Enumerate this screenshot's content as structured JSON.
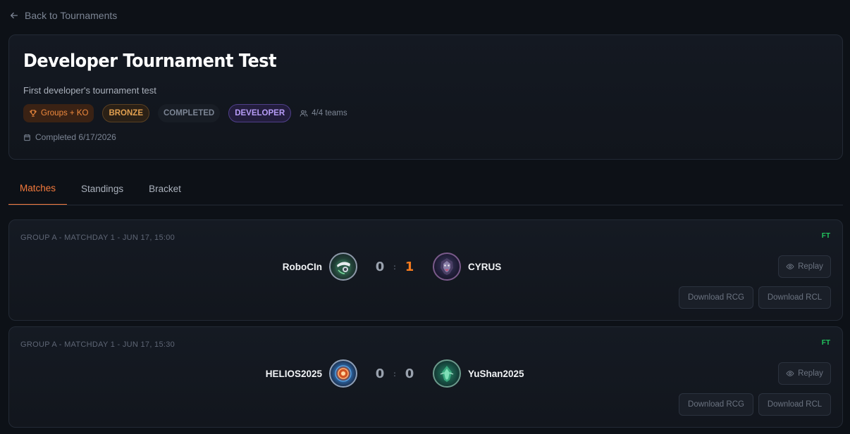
{
  "nav": {
    "back_label": "Back to Tournaments"
  },
  "tournament": {
    "title": "Developer Tournament Test",
    "description": "First developer's tournament test",
    "format": "Groups + KO",
    "tier": "BRONZE",
    "status": "COMPLETED",
    "type": "DEVELOPER",
    "teams": "4/4 teams",
    "completed": "Completed 6/17/2026"
  },
  "tabs": [
    {
      "label": "Matches",
      "active": true
    },
    {
      "label": "Standings",
      "active": false
    },
    {
      "label": "Bracket",
      "active": false
    }
  ],
  "matches": [
    {
      "label": "GROUP A - MATCHDAY 1 - JUN 17, 15:00",
      "state": "FT",
      "home": {
        "name": "RoboCIn",
        "score": "0",
        "logo": "robocin-logo"
      },
      "away": {
        "name": "CYRUS",
        "score": "1",
        "logo": "cyrus-logo"
      },
      "replay_label": "Replay",
      "download_rcg_label": "Download RCG",
      "download_rcl_label": "Download RCL"
    },
    {
      "label": "GROUP A - MATCHDAY 1 - JUN 17, 15:30",
      "state": "FT",
      "home": {
        "name": "HELIOS2025",
        "score": "0",
        "logo": "helios-logo"
      },
      "away": {
        "name": "YuShan2025",
        "score": "0",
        "logo": "yushan-logo"
      },
      "replay_label": "Replay",
      "download_rcg_label": "Download RCG",
      "download_rcl_label": "Download RCL"
    }
  ],
  "colors": {
    "accent": "#f47a3c",
    "ft": "#22c55e",
    "developer": "#b79cf8",
    "bronze": "#e2a050"
  }
}
